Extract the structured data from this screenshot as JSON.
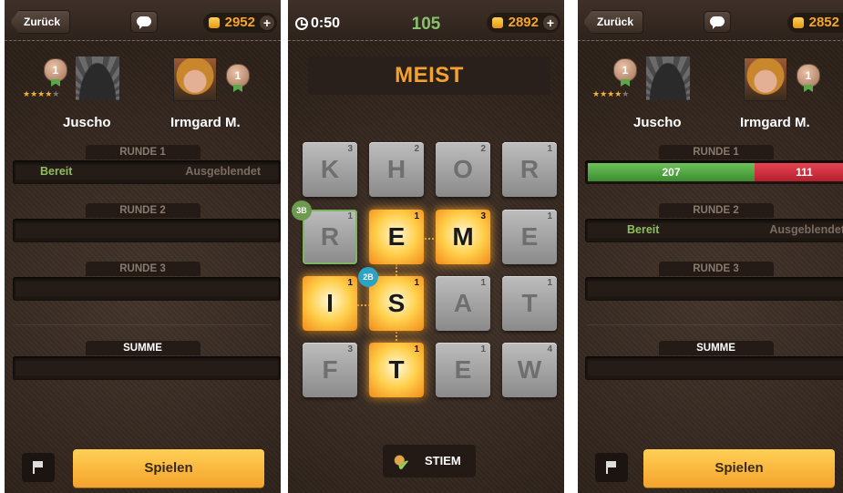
{
  "panels": [
    {
      "back_label": "Zurück",
      "coins": "2952",
      "players": [
        {
          "name": "Juscho",
          "level": "1",
          "stars": "★★★★",
          "stars_off": "★"
        },
        {
          "name": "Irmgard M.",
          "level": "1"
        }
      ],
      "rounds": [
        {
          "label": "RUNDE 1",
          "left": "Bereit",
          "right": "Ausgeblendet"
        },
        {
          "label": "RUNDE 2"
        },
        {
          "label": "RUNDE 3"
        }
      ],
      "total_label": "SUMME",
      "play_label": "Spielen"
    },
    {
      "timer": "0:50",
      "score": "105",
      "coins": "2892",
      "word": "MEIST",
      "board": [
        {
          "letter": "K",
          "points": "3",
          "selected": false
        },
        {
          "letter": "H",
          "points": "2",
          "selected": false
        },
        {
          "letter": "O",
          "points": "2",
          "selected": false
        },
        {
          "letter": "R",
          "points": "1",
          "selected": false
        },
        {
          "letter": "R",
          "points": "1",
          "selected": false
        },
        {
          "letter": "E",
          "points": "1",
          "selected": true
        },
        {
          "letter": "M",
          "points": "3",
          "selected": true
        },
        {
          "letter": "E",
          "points": "1",
          "selected": false
        },
        {
          "letter": "I",
          "points": "1",
          "selected": true
        },
        {
          "letter": "S",
          "points": "1",
          "selected": true
        },
        {
          "letter": "A",
          "points": "1",
          "selected": false
        },
        {
          "letter": "T",
          "points": "1",
          "selected": false
        },
        {
          "letter": "F",
          "points": "3",
          "selected": false
        },
        {
          "letter": "T",
          "points": "1",
          "selected": true
        },
        {
          "letter": "E",
          "points": "1",
          "selected": false
        },
        {
          "letter": "W",
          "points": "4",
          "selected": false
        }
      ],
      "bonuses": [
        {
          "label": "3B",
          "color": "#6c9a4e"
        },
        {
          "label": "2B",
          "color": "#2aa3c4"
        }
      ],
      "hint_label": "STIEM"
    },
    {
      "back_label": "Zurück",
      "coins": "2852",
      "players": [
        {
          "name": "Juscho",
          "level": "1",
          "stars": "★★★★",
          "stars_off": "★"
        },
        {
          "name": "Irmgard M.",
          "level": "1"
        }
      ],
      "rounds": [
        {
          "label": "RUNDE 1",
          "score_left": "207",
          "score_right": "111"
        },
        {
          "label": "RUNDE 2",
          "left": "Bereit",
          "right": "Ausgeblendet"
        },
        {
          "label": "RUNDE 3"
        }
      ],
      "total_label": "SUMME",
      "play_label": "Spielen"
    }
  ],
  "colors": {
    "accent": "#f4a12e",
    "ready": "#8fbe5f",
    "score_green": "#4caf3e",
    "score_red": "#d6303f"
  }
}
